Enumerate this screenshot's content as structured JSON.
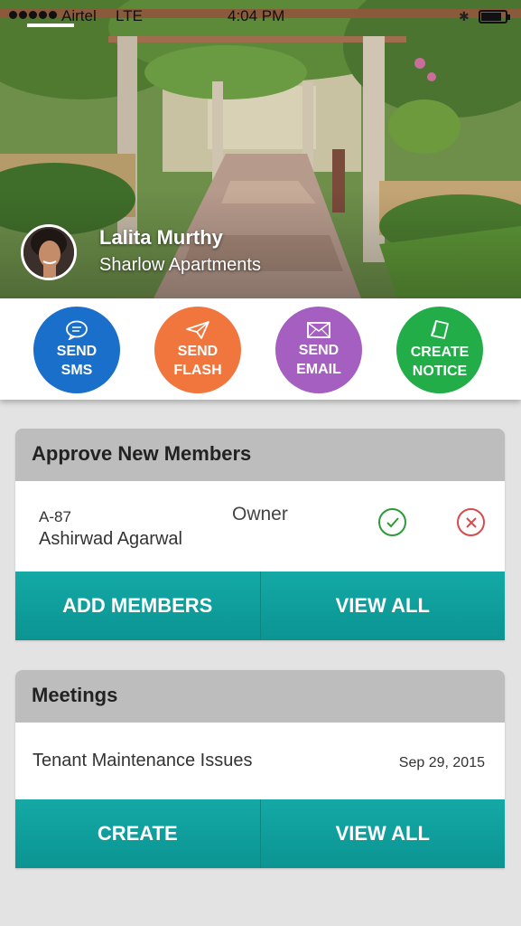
{
  "status_bar": {
    "carrier": "Airtel",
    "network": "LTE",
    "time": "4:04 PM",
    "battery_level": 0.85
  },
  "profile": {
    "name": "Lalita Murthy",
    "building": "Sharlow Apartments"
  },
  "actions": [
    {
      "line1": "SEND",
      "line2": "SMS",
      "icon": "chat-bubble-icon",
      "color": "#1a6fca"
    },
    {
      "line1": "SEND",
      "line2": "FLASH",
      "icon": "paper-plane-icon",
      "color": "#f1763d"
    },
    {
      "line1": "SEND",
      "line2": "EMAIL",
      "icon": "envelope-icon",
      "color": "#a55fc0"
    },
    {
      "line1": "CREATE",
      "line2": "NOTICE",
      "icon": "note-icon",
      "color": "#22ad49"
    }
  ],
  "approve_members": {
    "title": "Approve New Members",
    "member": {
      "unit": "A-87",
      "name": "Ashirwad Agarwal",
      "role": "Owner"
    },
    "buttons": {
      "add": "ADD MEMBERS",
      "view_all": "VIEW ALL"
    }
  },
  "meetings": {
    "title": "Meetings",
    "item": {
      "title": "Tenant Maintenance Issues",
      "date": "Sep 29, 2015"
    },
    "buttons": {
      "create": "CREATE",
      "view_all": "VIEW ALL"
    }
  },
  "colors": {
    "teal": "#0b9492",
    "approve_green": "#2f9a3a",
    "reject_red": "#d94b4b"
  }
}
